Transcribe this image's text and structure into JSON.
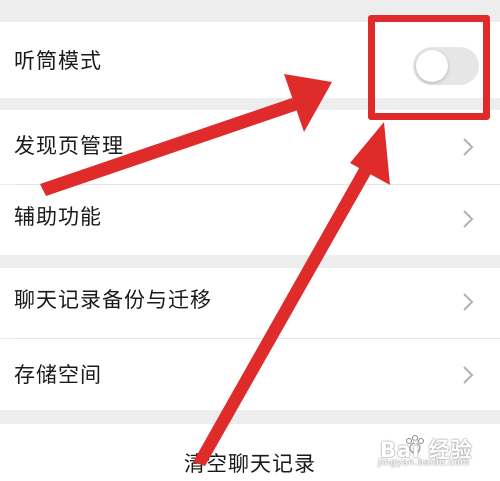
{
  "settings": {
    "earpiece_mode": {
      "label": "听筒模式",
      "enabled": false
    },
    "discover_manage": {
      "label": "发现页管理"
    },
    "accessibility": {
      "label": "辅助功能"
    },
    "chat_backup": {
      "label": "聊天记录备份与迁移"
    },
    "storage": {
      "label": "存储空间"
    },
    "clear_history": {
      "label": "清空聊天记录"
    }
  },
  "watermark": {
    "brand": "Bai 经验",
    "site": "jingyan.baidu.com"
  },
  "colors": {
    "annotation_red": "#e02b2b",
    "background": "#ededed",
    "toggle_off": "#e6e6e6"
  }
}
